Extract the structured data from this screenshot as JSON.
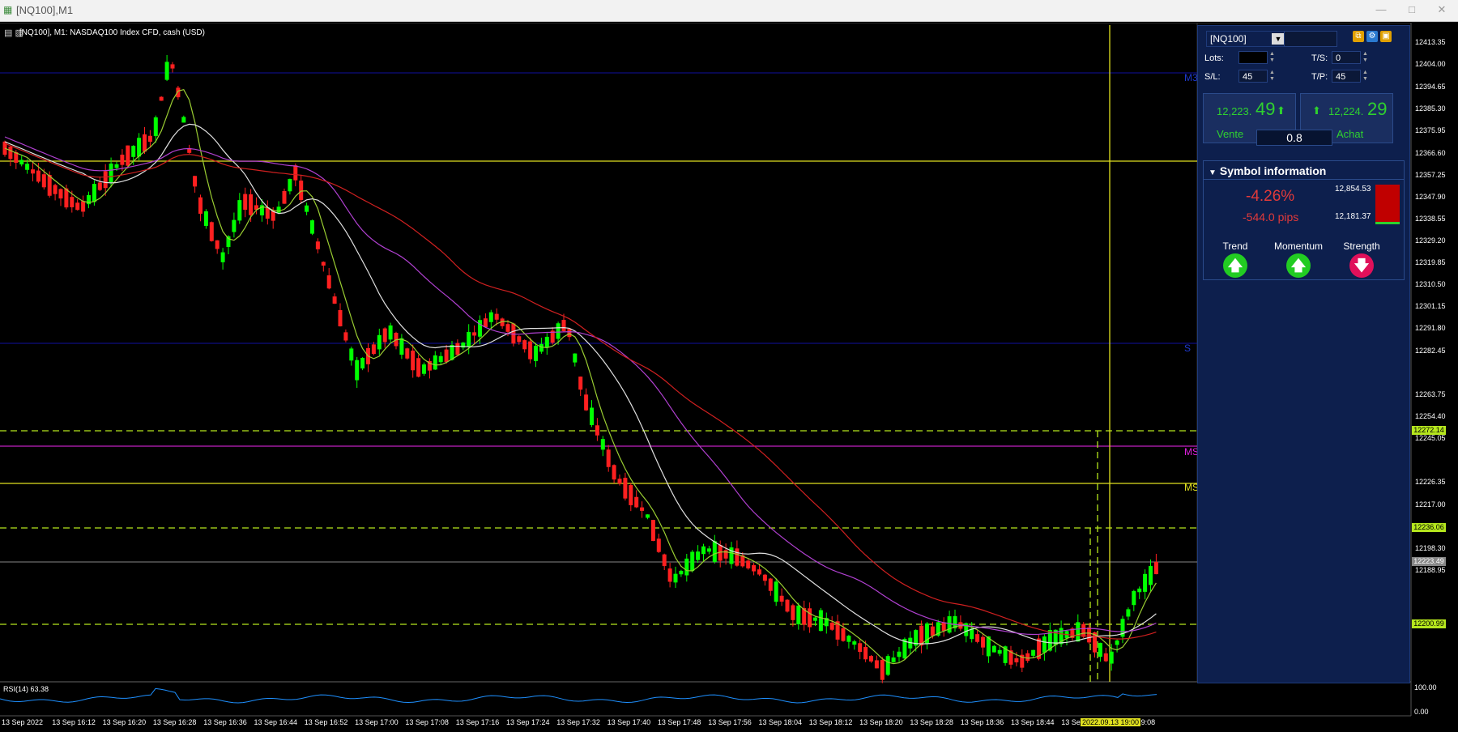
{
  "window": {
    "title": "[NQ100],M1",
    "controls": [
      "—",
      "□",
      "✕"
    ]
  },
  "chart": {
    "symbol_line": "[NQ100], M1:  NASDAQ100 Index CFD, cash (USD)",
    "rsi_label": "RSI(14) 63.38",
    "rsi_levels": [
      "100.00",
      "0.00"
    ],
    "price_axis": [
      "12413.35",
      "12404.00",
      "12394.65",
      "12385.30",
      "12375.95",
      "12366.60",
      "12357.25",
      "12347.90",
      "12338.55",
      "12329.20",
      "12319.85",
      "12310.50",
      "12301.15",
      "12291.80",
      "12282.45",
      "12263.75",
      "12254.40",
      "12245.05",
      "12226.35",
      "12217.00",
      "12207.65",
      "12198.30",
      "12188.95"
    ],
    "price_tags": [
      {
        "text": "12272.14",
        "bg": "#b5e61d",
        "fg": "#000"
      },
      {
        "text": "12236.06",
        "bg": "#b5e61d",
        "fg": "#000"
      },
      {
        "text": "12223.49",
        "bg": "#888888",
        "fg": "#fff"
      },
      {
        "text": "12200.99",
        "bg": "#b5e61d",
        "fg": "#000"
      }
    ],
    "time_axis": [
      "13 Sep 2022",
      "13 Sep 16:12",
      "13 Sep 16:20",
      "13 Sep 16:28",
      "13 Sep 16:36",
      "13 Sep 16:44",
      "13 Sep 16:52",
      "13 Sep 17:00",
      "13 Sep 17:08",
      "13 Sep 17:16",
      "13 Sep 17:24",
      "13 Sep 17:32",
      "13 Sep 17:40",
      "13 Sep 17:48",
      "13 Sep 17:56",
      "13 Sep 18:04",
      "13 Sep 18:12",
      "13 Sep 18:20",
      "13 Sep 18:28",
      "13 Sep 18:36",
      "13 Sep 18:44",
      "13 Sep",
      "13 Sep 19:08"
    ],
    "time_highlight": "2022.09.13 19:00",
    "level_labels": [
      {
        "text": "M3",
        "color": "#1e3ad0"
      },
      {
        "text": "S",
        "color": "#1e3ad0"
      },
      {
        "text": "MS",
        "color": "#e020e0"
      },
      {
        "text": "MS",
        "color": "#e0e020"
      }
    ],
    "colors": {
      "up": "#00ff00",
      "down": "#ff2020",
      "ma_fast": "#9acd32",
      "ma_white": "#e0e0e0",
      "ma_red": "#d02020",
      "ma_purple": "#b040d0",
      "rsi": "#1e90ff"
    }
  },
  "panel": {
    "symbol": "[NQ100]",
    "lots_label": "Lots:",
    "lots_value": "",
    "ts_label": "T/S:",
    "ts_value": "0",
    "sl_label": "S/L:",
    "sl_value": "45",
    "tp_label": "T/P:",
    "tp_value": "45",
    "sell_small": "12,223.",
    "sell_big": "49",
    "sell_label": "Vente",
    "buy_small": "12,224.",
    "buy_big": "29",
    "buy_label": "Achat",
    "spread": "0.8",
    "info_title": "Symbol information",
    "change_pct": "-4.26%",
    "change_pips": "-544.0 pips",
    "high": "12,854.53",
    "low": "12,181.37",
    "trend_label": "Trend",
    "momentum_label": "Momentum",
    "strength_label": "Strength",
    "trend_icon": "arrow-up-icon",
    "momentum_icon": "arrow-up-icon",
    "strength_icon": "arrow-down-icon"
  }
}
